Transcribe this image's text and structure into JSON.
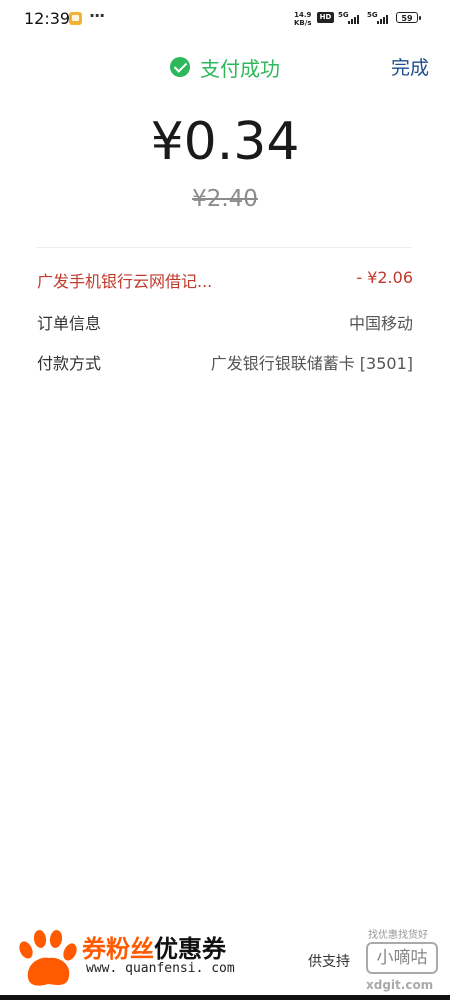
{
  "status_bar": {
    "time": "12:39",
    "more": "···",
    "net_speed_value": "14.9",
    "net_speed_unit": "KB/s",
    "hd": "HD",
    "signal_1": "5G",
    "signal_2": "5G",
    "battery": "59"
  },
  "header": {
    "title": "支付成功",
    "done": "完成",
    "accent_color": "#2eb85c"
  },
  "payment": {
    "amount": "¥0.34",
    "original_amount": "¥2.40"
  },
  "details": [
    {
      "label": "广发手机银行云网借记...",
      "value": "- ¥2.06",
      "color": "#c0392b"
    },
    {
      "label": "订单信息",
      "value": "中国移动"
    },
    {
      "label": "付款方式",
      "value": "广发银行银联储蓄卡 [3501]"
    }
  ],
  "watermark": {
    "brand_orange": "券粉丝",
    "brand_black": "优惠券",
    "url": "www. quanfensi. com",
    "support_text": "供支持",
    "xdg_small": "找优惠找货好",
    "xdg_name": "小嘀咕",
    "xdg_url": "xdgit.com"
  }
}
